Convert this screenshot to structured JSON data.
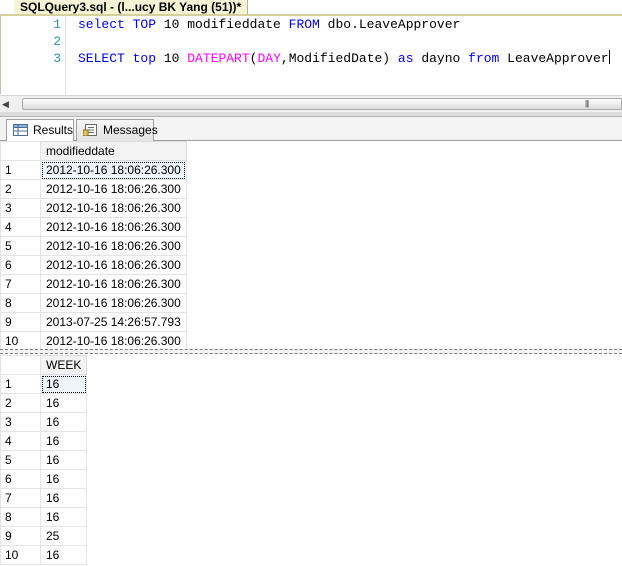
{
  "document_tab": {
    "title": "SQLQuery3.sql - (l...ucy BK Yang (51))*"
  },
  "editor": {
    "lines": [
      {
        "number": "1",
        "tokens": [
          {
            "text": "select",
            "kind": "kw"
          },
          {
            "text": " ",
            "kind": "pl"
          },
          {
            "text": "TOP",
            "kind": "kw"
          },
          {
            "text": " 10 modifieddate ",
            "kind": "pl"
          },
          {
            "text": "FROM",
            "kind": "kw"
          },
          {
            "text": " dbo.LeaveApprover",
            "kind": "pl"
          }
        ]
      },
      {
        "number": "2",
        "tokens": []
      },
      {
        "number": "3",
        "tokens": [
          {
            "text": "SELECT",
            "kind": "kw"
          },
          {
            "text": " ",
            "kind": "pl"
          },
          {
            "text": "top",
            "kind": "kw"
          },
          {
            "text": " 10 ",
            "kind": "pl"
          },
          {
            "text": "DATEPART",
            "kind": "fn"
          },
          {
            "text": "(",
            "kind": "pl"
          },
          {
            "text": "DAY",
            "kind": "fn"
          },
          {
            "text": ",ModifiedDate) ",
            "kind": "pl"
          },
          {
            "text": "as",
            "kind": "kw"
          },
          {
            "text": " dayno ",
            "kind": "pl"
          },
          {
            "text": "from",
            "kind": "kw"
          },
          {
            "text": " LeaveApprover",
            "kind": "pl"
          }
        ]
      }
    ],
    "colors": {
      "keyword": "#0000ff",
      "function": "#ff00ff",
      "line_number": "#2b91af"
    }
  },
  "result_tabs": [
    {
      "label": "Results",
      "icon": "grid-icon",
      "active": true
    },
    {
      "label": "Messages",
      "icon": "messages-icon",
      "active": false
    }
  ],
  "result_grid_1": {
    "column": "modifieddate",
    "rows": [
      {
        "n": "1",
        "v": "2012-10-16 18:06:26.300"
      },
      {
        "n": "2",
        "v": "2012-10-16 18:06:26.300"
      },
      {
        "n": "3",
        "v": "2012-10-16 18:06:26.300"
      },
      {
        "n": "4",
        "v": "2012-10-16 18:06:26.300"
      },
      {
        "n": "5",
        "v": "2012-10-16 18:06:26.300"
      },
      {
        "n": "6",
        "v": "2012-10-16 18:06:26.300"
      },
      {
        "n": "7",
        "v": "2012-10-16 18:06:26.300"
      },
      {
        "n": "8",
        "v": "2012-10-16 18:06:26.300"
      },
      {
        "n": "9",
        "v": "2013-07-25 14:26:57.793"
      },
      {
        "n": "10",
        "v": "2012-10-16 18:06:26.300"
      }
    ]
  },
  "result_grid_2": {
    "column": "WEEK",
    "rows": [
      {
        "n": "1",
        "v": "16"
      },
      {
        "n": "2",
        "v": "16"
      },
      {
        "n": "3",
        "v": "16"
      },
      {
        "n": "4",
        "v": "16"
      },
      {
        "n": "5",
        "v": "16"
      },
      {
        "n": "6",
        "v": "16"
      },
      {
        "n": "7",
        "v": "16"
      },
      {
        "n": "8",
        "v": "16"
      },
      {
        "n": "9",
        "v": "25"
      },
      {
        "n": "10",
        "v": "16"
      }
    ]
  }
}
